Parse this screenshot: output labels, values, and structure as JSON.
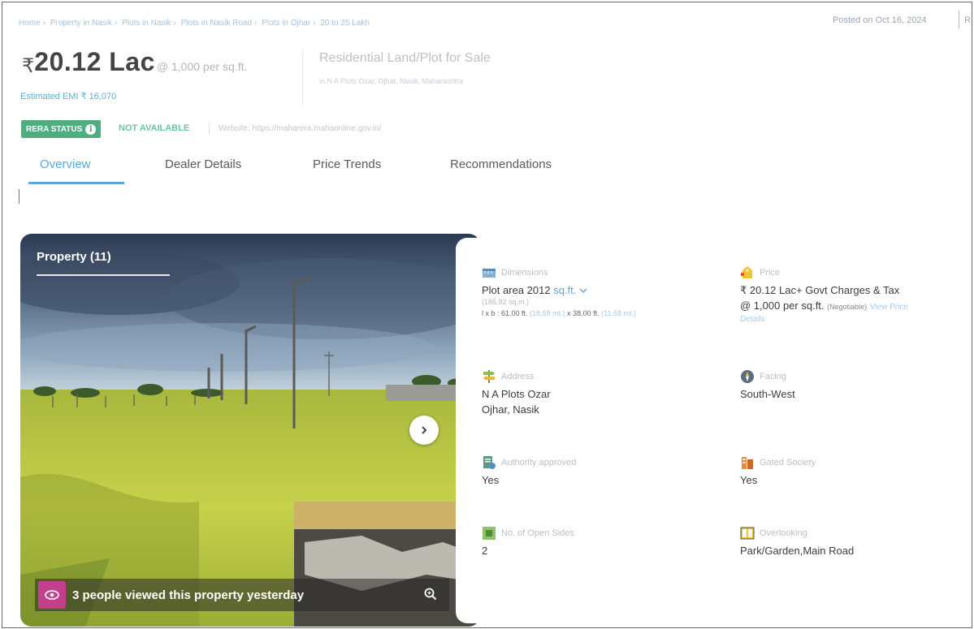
{
  "breadcrumb": [
    "Home",
    "Property in Nasik",
    "Plots in Nasik",
    "Plots in Nasik Road",
    "Plots in Ojhar",
    "20 to 25 Lakh"
  ],
  "posted": "Posted on Oct 16, 2024",
  "posted_next": "R",
  "price": {
    "currency": "₹",
    "amount": "20.12 Lac",
    "per_sqft": "@ 1,000 per sq.ft.",
    "emi": "Estimated EMI ₹ 16,070"
  },
  "property_title": "Residential Land/Plot for Sale",
  "property_location": "in N A Plots Ozar, Ojhar, Nasik, Maharashtra",
  "rera": {
    "badge": "RERA STATUS",
    "status": "NOT AVAILABLE",
    "website": "Website: https://maharera.mahaonline.gov.in/"
  },
  "tabs": [
    "Overview",
    "Dealer Details",
    "Price Trends",
    "Recommendations"
  ],
  "gallery": {
    "label": "Property (11)",
    "viewed": "3 people viewed this property yesterday"
  },
  "details": {
    "dimensions": {
      "label": "Dimensions",
      "value": "Plot area 2012",
      "unit": "sq.ft.",
      "sub": "(186.92 sq.m.)",
      "lxb_prefix": "l x b : 61.00 ft.",
      "l_m": "(18.59 mt.)",
      "lxb_mid": "x 38.00 ft.",
      "b_m": "(11.58 mt.)"
    },
    "price": {
      "label": "Price",
      "value": "₹ 20.12 Lac+ Govt Charges & Tax",
      "rate": "@ 1,000 per sq.ft.",
      "negotiable": "(Negotiable)",
      "link1": "View Price",
      "link2": "Details"
    },
    "address": {
      "label": "Address",
      "line1": "N A Plots Ozar",
      "line2": "Ojhar, Nasik"
    },
    "facing": {
      "label": "Facing",
      "value": "South-West"
    },
    "authority": {
      "label": "Authority approved",
      "value": "Yes"
    },
    "gated": {
      "label": "Gated Society",
      "value": "Yes"
    },
    "open_sides": {
      "label": "No. of Open Sides",
      "value": "2"
    },
    "overlooking": {
      "label": "Overlooking",
      "value": "Park/Garden,Main Road"
    }
  },
  "colors": {
    "accent": "#5aa7d9",
    "rera_green": "#4fad80",
    "eye_badge": "#c5408a"
  },
  "icons": [
    "info-icon",
    "chevron-down-icon",
    "chevron-right-icon",
    "eye-icon",
    "zoom-icon",
    "ruler-icon",
    "price-tag-icon",
    "signpost-icon",
    "compass-icon",
    "approved-doc-icon",
    "building-icon",
    "open-sides-icon",
    "overlooking-icon"
  ]
}
